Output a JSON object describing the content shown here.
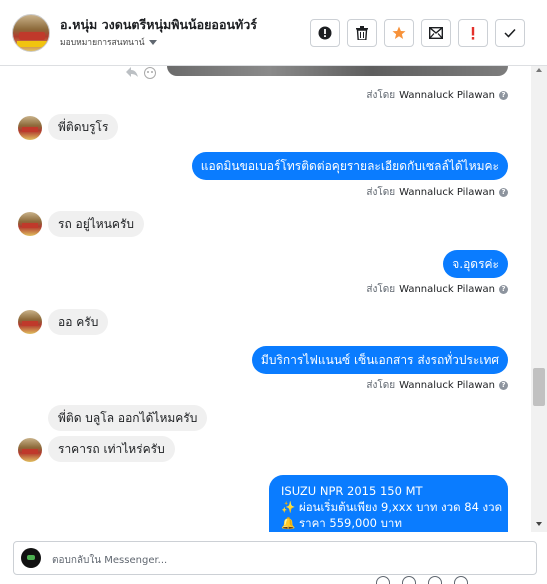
{
  "header": {
    "name": "อ.หนุ่ม วงดนตรีหนุ่มพินน้อยออนทัวร์",
    "assign_label": "มอบหมายการสนทนาน์"
  },
  "toolbar": {
    "buttons": [
      {
        "icon": "alert-circle-icon"
      },
      {
        "icon": "trash-icon"
      },
      {
        "icon": "star-icon",
        "color": "#f7923a"
      },
      {
        "icon": "mark-unread-icon"
      },
      {
        "icon": "spam-exclamation-icon",
        "color": "#e4312b"
      },
      {
        "icon": "checkmark-icon"
      }
    ]
  },
  "messages": [
    {
      "side": "out",
      "type": "image"
    },
    {
      "side": "meta",
      "sent_by_label": "ส่งโดย",
      "sender": "Wannaluck Pilawan"
    },
    {
      "side": "in",
      "text": "พี่ติดบรูโร"
    },
    {
      "side": "out",
      "text": "แอดมินขอเบอร์โทรติดต่อคุยรายละเอียดกับเซลล์ได้ไหมคะ"
    },
    {
      "side": "meta",
      "sent_by_label": "ส่งโดย",
      "sender": "Wannaluck Pilawan"
    },
    {
      "side": "in",
      "text": "รถ อยู่ไหนครับ"
    },
    {
      "side": "out",
      "text": "จ.อุดรค่ะ"
    },
    {
      "side": "meta",
      "sent_by_label": "ส่งโดย",
      "sender": "Wannaluck Pilawan"
    },
    {
      "side": "in",
      "text": "ออ ครับ"
    },
    {
      "side": "out",
      "text": "มีบริการไฟแนนซ์ เซ็นเอกสาร ส่งรถทั่วประเทศ"
    },
    {
      "side": "meta",
      "sent_by_label": "ส่งโดย",
      "sender": "Wannaluck Pilawan"
    },
    {
      "side": "in",
      "text": "พี่ติด บลูโล   ออกได้ไหมครับ"
    },
    {
      "side": "in",
      "text": "ราคารถ เท่าไหร่ครับ"
    },
    {
      "side": "out",
      "type": "card",
      "lines": [
        "ISUZU NPR 2015 150 MT",
        "✨ ผ่อนเริ่มต้นเพียง 9,xxx บาท งวด 84 งวด",
        "🔔 ราคา 559,000 บาท"
      ]
    }
  ],
  "composer": {
    "placeholder": "ตอบกลับใน Messenger..."
  }
}
